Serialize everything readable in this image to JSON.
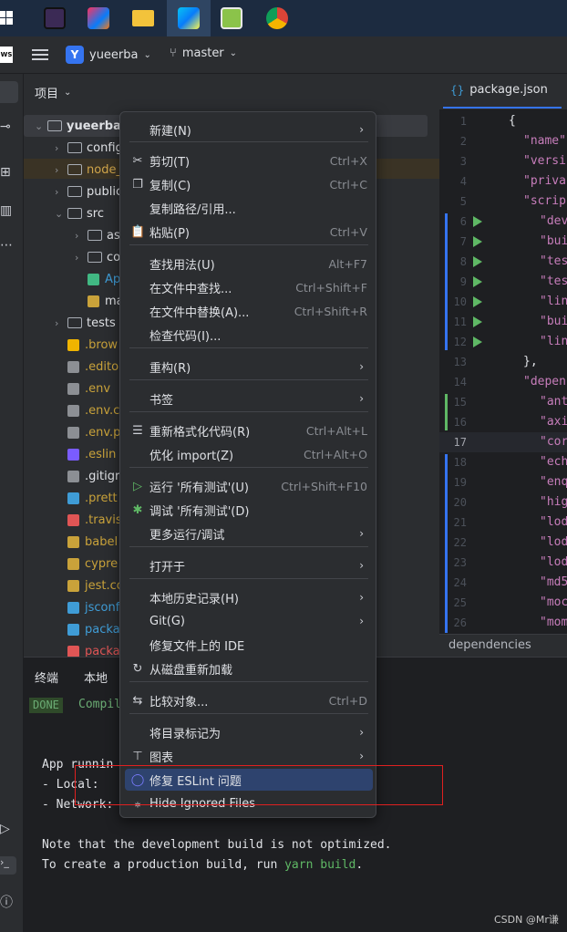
{
  "taskbar": {
    "icons": [
      "windows-start",
      "gamer-cat-app",
      "intellij-idea",
      "file-explorer",
      "webstorm",
      "notepad-app",
      "chrome"
    ],
    "colors": {
      "idea": "#fe315d",
      "explorer": "#f3c33b",
      "webstorm": "#07c3f2",
      "notepad": "#8bc34a",
      "chrome": "#db4437"
    }
  },
  "titlebar": {
    "ide_logo": "WS",
    "project_initial": "Y",
    "project_name": "yueerba",
    "branch": "master"
  },
  "project_panel": {
    "title": "项目",
    "tree": [
      {
        "label": "yueerba",
        "bold": true
      },
      {
        "label": "config"
      },
      {
        "label": "node_",
        "color": "#d0a54a"
      },
      {
        "label": "public"
      },
      {
        "label": "src"
      },
      {
        "label": "as"
      },
      {
        "label": "co"
      },
      {
        "label": "Ap",
        "color": "#3f9cd6"
      },
      {
        "label": "ma"
      },
      {
        "label": "tests"
      },
      {
        "label": ".brow",
        "color": "#c9a23a"
      },
      {
        "label": ".edito",
        "color": "#c9a23a"
      },
      {
        "label": ".env",
        "color": "#c9a23a"
      },
      {
        "label": ".env.c",
        "color": "#c9a23a"
      },
      {
        "label": ".env.p",
        "color": "#c9a23a"
      },
      {
        "label": ".eslin",
        "color": "#c9a23a"
      },
      {
        "label": ".gitigr"
      },
      {
        "label": ".prett",
        "color": "#c9a23a"
      },
      {
        "label": ".travis",
        "color": "#c9a23a"
      },
      {
        "label": "babel",
        "color": "#c9a23a"
      },
      {
        "label": "cypre",
        "color": "#c9a23a"
      },
      {
        "label": "jest.co",
        "color": "#c9a23a"
      },
      {
        "label": "jsconf",
        "color": "#3f9cd6"
      },
      {
        "label": "packa",
        "color": "#3f9cd6"
      },
      {
        "label": "packa",
        "color": "#e05555"
      }
    ]
  },
  "editor": {
    "tab": "package.json",
    "line_numbers": [
      "1",
      "2",
      "3",
      "4",
      "5",
      "6",
      "7",
      "8",
      "9",
      "10",
      "11",
      "12",
      "13",
      "14",
      "15",
      "16",
      "17",
      "18",
      "19",
      "20",
      "21",
      "22",
      "23",
      "24",
      "25",
      "26"
    ],
    "current_line": "17",
    "lines": [
      "{",
      "\"name\"",
      "\"versi",
      "\"priva",
      "\"scrip",
      "\"dev",
      "\"bui",
      "\"tes",
      "\"tes",
      "\"lin",
      "\"bui",
      "\"lin",
      "},",
      "\"depen",
      "\"ant",
      "\"axi",
      "\"cor",
      "\"ech",
      "\"enq",
      "\"hig",
      "\"lod",
      "\"lod",
      "\"lod",
      "\"md5",
      "\"moc",
      "\"mom"
    ],
    "breadcrumb": "dependencies"
  },
  "terminal": {
    "tab_terminal": "终端",
    "tab_local": "本地",
    "done_badge": "DONE",
    "compile_text": "Compil",
    "lines": [
      "App runnin",
      "- Local:",
      "- Network:",
      "Note that the development build is not optimized."
    ],
    "build_prefix": "To create a production build, run ",
    "build_cmd": "yarn build",
    "build_suffix": "."
  },
  "context_menu": {
    "items": [
      {
        "label": "新建(N)",
        "submenu": true
      },
      {
        "label": "剪切(T)",
        "shortcut": "Ctrl+X",
        "icon": "scissors-icon"
      },
      {
        "label": "复制(C)",
        "shortcut": "Ctrl+C",
        "icon": "copy-icon"
      },
      {
        "label": "复制路径/引用..."
      },
      {
        "label": "粘贴(P)",
        "shortcut": "Ctrl+V",
        "icon": "paste-icon"
      },
      {
        "label": "查找用法(U)",
        "shortcut": "Alt+F7"
      },
      {
        "label": "在文件中查找...",
        "shortcut": "Ctrl+Shift+F"
      },
      {
        "label": "在文件中替换(A)...",
        "shortcut": "Ctrl+Shift+R"
      },
      {
        "label": "检查代码(I)..."
      },
      {
        "label": "重构(R)",
        "submenu": true
      },
      {
        "label": "书签",
        "submenu": true
      },
      {
        "label": "重新格式化代码(R)",
        "shortcut": "Ctrl+Alt+L",
        "icon": "reformat-icon"
      },
      {
        "label": "优化 import(Z)",
        "shortcut": "Ctrl+Alt+O"
      },
      {
        "label": "运行 '所有测试'(U)",
        "shortcut": "Ctrl+Shift+F10",
        "icon": "run-icon"
      },
      {
        "label": "调试 '所有测试'(D)",
        "icon": "debug-icon"
      },
      {
        "label": "更多运行/调试",
        "submenu": true
      },
      {
        "label": "打开于",
        "submenu": true
      },
      {
        "label": "本地历史记录(H)",
        "submenu": true
      },
      {
        "label": "Git(G)",
        "submenu": true
      },
      {
        "label": "修复文件上的 IDE"
      },
      {
        "label": "从磁盘重新加载",
        "icon": "reload-icon"
      },
      {
        "label": "比较对象...",
        "shortcut": "Ctrl+D",
        "icon": "compare-icon"
      },
      {
        "label": "将目录标记为",
        "submenu": true
      },
      {
        "label": "图表",
        "submenu": true,
        "icon": "diagram-icon"
      },
      {
        "label": "修复 ESLint 问题",
        "icon": "eslint-icon",
        "selected": true
      },
      {
        "label": "Hide Ignored Files",
        "icon": "hide-ignored-icon"
      }
    ]
  },
  "watermark": "CSDN @Mr谦"
}
